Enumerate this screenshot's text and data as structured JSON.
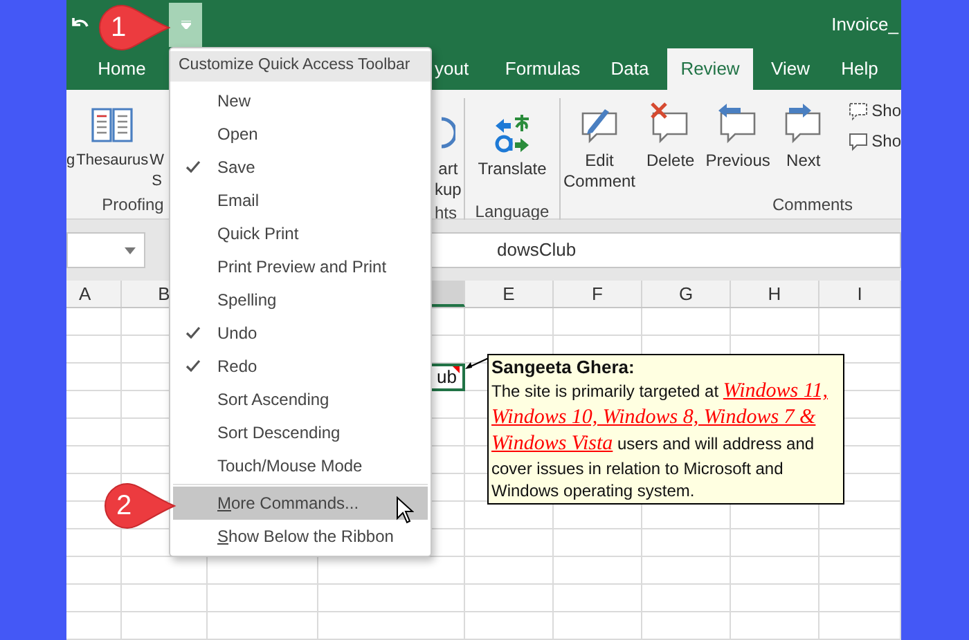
{
  "title_bar": {
    "title": "Invoice_"
  },
  "tabs": [
    {
      "label": "Home",
      "selected": false
    },
    {
      "label": "yout",
      "selected": false
    },
    {
      "label": "Formulas",
      "selected": false
    },
    {
      "label": "Data",
      "selected": false
    },
    {
      "label": "Review",
      "selected": true
    },
    {
      "label": "View",
      "selected": false
    },
    {
      "label": "Help",
      "selected": false
    }
  ],
  "ribbon": {
    "groups": [
      {
        "label": "Proofing",
        "buttons": [
          {
            "lines": [
              "g"
            ]
          },
          {
            "lines": [
              "Thesaurus"
            ]
          },
          {
            "lines": [
              "W",
              "S"
            ]
          }
        ]
      },
      {
        "label": "hts",
        "buttons": [
          {
            "lines": [
              "art",
              "kup"
            ]
          }
        ]
      },
      {
        "label": "Language",
        "buttons": [
          {
            "lines": [
              "Translate"
            ]
          }
        ]
      },
      {
        "label": "Comments",
        "buttons": [
          {
            "lines": [
              "Edit",
              "Comment"
            ]
          },
          {
            "lines": [
              "Delete"
            ]
          },
          {
            "lines": [
              "Previous"
            ]
          },
          {
            "lines": [
              "Next"
            ]
          }
        ],
        "small_buttons": [
          {
            "label": "Sho"
          },
          {
            "label": "Sho"
          }
        ]
      }
    ]
  },
  "formula_bar": {
    "content": "dowsClub"
  },
  "columns": [
    {
      "label": "A",
      "selected": false
    },
    {
      "label": "B",
      "selected": false
    },
    {
      "selected": true
    },
    {
      "label": "E",
      "selected": false
    },
    {
      "label": "F",
      "selected": false
    },
    {
      "label": "G",
      "selected": false
    },
    {
      "label": "H",
      "selected": false
    },
    {
      "label": "I",
      "selected": false
    }
  ],
  "selected_cell": {
    "text": "ub"
  },
  "comment": {
    "author": "Sangeeta Ghera:",
    "text": "The site is primarily targeted at *Windows 11, Windows 10, Windows 8, Windows 7 & Windows Vista* users and will address and cover issues in relation to Microsoft and Windows operating system."
  },
  "menu": {
    "title": "Customize Quick Access Toolbar",
    "items": [
      {
        "label": "New",
        "checked": false,
        "highlighted": false,
        "access_key": false
      },
      {
        "label": "Open",
        "checked": false,
        "highlighted": false,
        "access_key": false
      },
      {
        "label": "Save",
        "checked": true,
        "highlighted": false,
        "access_key": false
      },
      {
        "label": "Email",
        "checked": false,
        "highlighted": false,
        "access_key": false
      },
      {
        "label": "Quick Print",
        "checked": false,
        "highlighted": false,
        "access_key": false
      },
      {
        "label": "Print Preview and Print",
        "checked": false,
        "highlighted": false,
        "access_key": false
      },
      {
        "label": "Spelling",
        "checked": false,
        "highlighted": false,
        "access_key": false
      },
      {
        "label": "Undo",
        "checked": true,
        "highlighted": false,
        "access_key": false
      },
      {
        "label": "Redo",
        "checked": true,
        "highlighted": false,
        "access_key": false
      },
      {
        "label": "Sort Ascending",
        "checked": false,
        "highlighted": false,
        "access_key": false
      },
      {
        "label": "Sort Descending",
        "checked": false,
        "highlighted": false,
        "access_key": false
      },
      {
        "label": "Touch/Mouse Mode",
        "checked": false,
        "highlighted": false,
        "access_key": false
      }
    ],
    "more_items": [
      {
        "label": "More Commands...",
        "checked": false,
        "highlighted": true,
        "access_key": true
      },
      {
        "label": "Show Below the Ribbon",
        "checked": false,
        "highlighted": false,
        "access_key": true
      }
    ]
  },
  "callouts": [
    {
      "number": "1"
    },
    {
      "number": "2"
    }
  ]
}
